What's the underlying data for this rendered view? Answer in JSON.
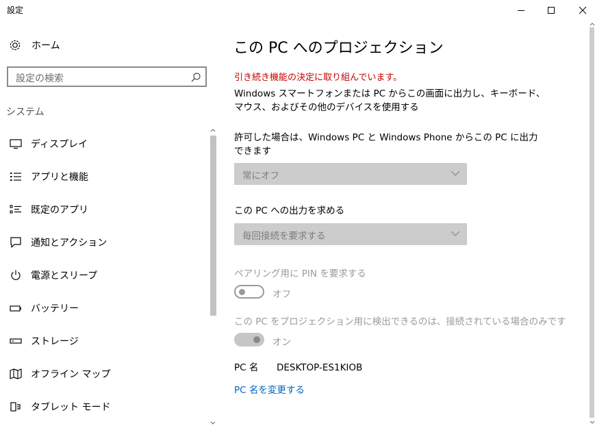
{
  "window": {
    "title": "設定"
  },
  "sidebar": {
    "home_label": "ホーム",
    "search_placeholder": "設定の検索",
    "section_header": "システム",
    "items": [
      {
        "label": "ディスプレイ",
        "icon": "monitor-icon"
      },
      {
        "label": "アプリと機能",
        "icon": "apps-list-icon"
      },
      {
        "label": "既定のアプリ",
        "icon": "default-apps-icon"
      },
      {
        "label": "通知とアクション",
        "icon": "notification-icon"
      },
      {
        "label": "電源とスリープ",
        "icon": "power-icon"
      },
      {
        "label": "バッテリー",
        "icon": "battery-icon"
      },
      {
        "label": "ストレージ",
        "icon": "storage-icon"
      },
      {
        "label": "オフライン マップ",
        "icon": "map-icon"
      },
      {
        "label": "タブレット モード",
        "icon": "tablet-mode-icon"
      }
    ]
  },
  "main": {
    "title": "この PC へのプロジェクション",
    "warning": "引き続き機能の決定に取り組んでいます。",
    "description": "Windows スマートフォンまたは PC からこの画面に出力し、キーボード、マウス、およびその他のデバイスを使用する",
    "allow_label": "許可した場合は、Windows PC と Windows Phone からこの PC に出力できます",
    "allow_value": "常にオフ",
    "ask_label": "この PC への出力を求める",
    "ask_value": "毎回接続を要求する",
    "pin_label": "ペアリング用に PIN を要求する",
    "pin_state": "オフ",
    "power_label": "この PC をプロジェクション用に検出できるのは、接続されている場合のみです",
    "power_state": "オン",
    "pc_name_label": "PC 名",
    "pc_name_value": "DESKTOP-ES1KIOB",
    "rename_link": "PC 名を変更する"
  },
  "colors": {
    "warning": "#c30000",
    "link": "#0067c0",
    "disabled": "#9a9a9a"
  }
}
